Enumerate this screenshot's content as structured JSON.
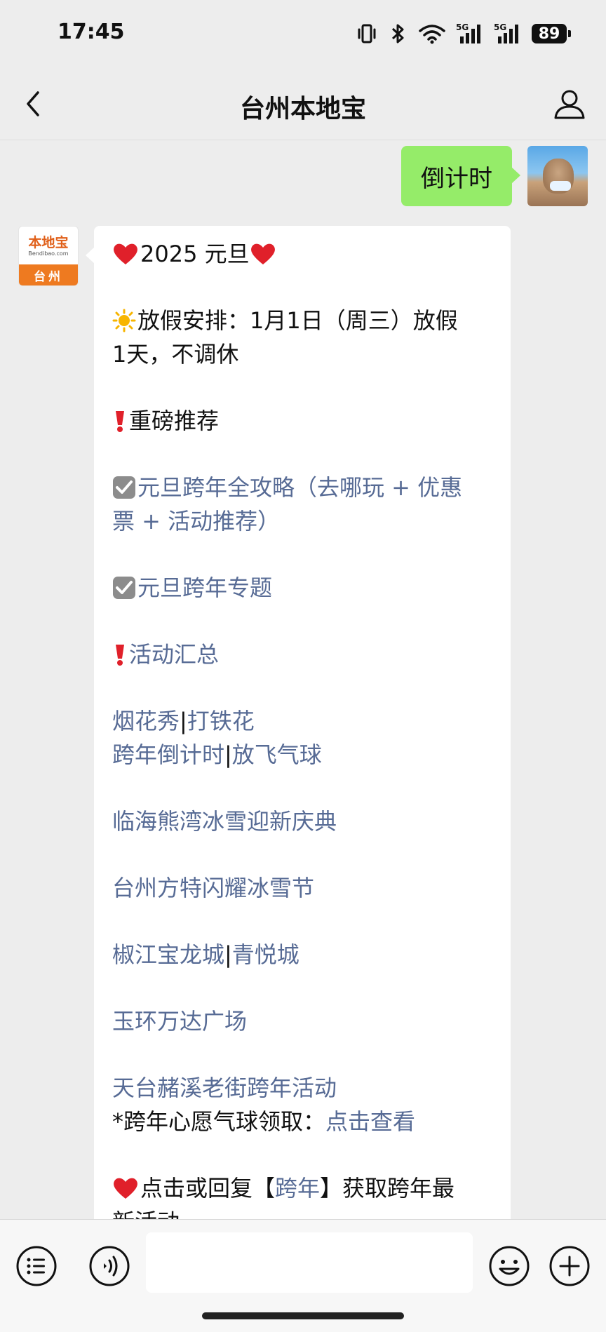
{
  "status_bar": {
    "time": "17:45",
    "network_1": "5G",
    "network_2": "5G",
    "battery": "89",
    "icons": [
      "vibrate-icon",
      "bluetooth-icon",
      "wifi-icon",
      "signal-icon",
      "signal-icon",
      "battery-icon"
    ]
  },
  "nav": {
    "title": "台州本地宝",
    "back_icon": "chevron-left-icon",
    "profile_icon": "person-icon"
  },
  "chat": {
    "outgoing_message": "倒计时",
    "bot_avatar": {
      "brand": "本地宝",
      "brand_sub": "Bendibao.com",
      "city": "台州"
    },
    "reply": {
      "header": "2025 元旦",
      "holiday_label": "放假安排：1月1日（周三）放假",
      "holiday_cont": "1天，不调休",
      "recommend_label": "重磅推荐",
      "guide_link_1": "元旦跨年全攻略（去哪玩 + 优惠",
      "guide_link_2": "票 + 活动推荐）",
      "topic_link": "元旦跨年专题",
      "summary_link": "活动汇总",
      "fireworks": "烟花秀",
      "iron_flowers": "打铁花",
      "countdown": "跨年倒计时",
      "balloons": "放飞气球",
      "linhai": "临海熊湾冰雪迎新庆典",
      "fantawild": "台州方特闪耀冰雪节",
      "jiaojiang": "椒江宝龙城",
      "qingyue": "青悦城",
      "yuhuan": "玉环万达广场",
      "tiantai": "天台赭溪老街跨年活动",
      "wish_label": "*跨年心愿气球领取：",
      "wish_link": "点击查看",
      "reply_prefix": "点击或回复【",
      "reply_keyword": "跨年",
      "reply_suffix": "】获取跨年最",
      "reply_cont": "新活动",
      "separator": "|"
    }
  },
  "input_bar": {
    "icons": [
      "menu-list-icon",
      "voice-icon",
      "emoji-icon",
      "plus-icon"
    ],
    "input_value": ""
  },
  "colors": {
    "link": "#576b95",
    "outgoing_bubble": "#95ec69",
    "background": "#ededed",
    "heart": "#e0202a"
  }
}
